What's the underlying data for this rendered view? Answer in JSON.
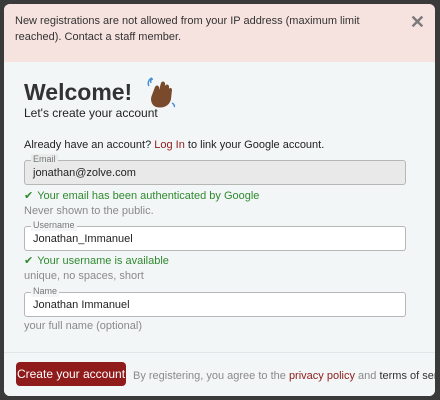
{
  "alert": {
    "message": "New registrations are not allowed from your IP address (maximum limit reached). Contact a staff member.",
    "close": "✕"
  },
  "header": {
    "title": "Welcome!",
    "subtitle": "Let's create your account",
    "wave_icon": "waving-hand-icon"
  },
  "login": {
    "prefix": "Already have an account?",
    "link": "Log In",
    "suffix": "to link your Google account."
  },
  "email": {
    "label": "Email",
    "value": "jonathan@zolve.com",
    "status": "Your email has been authenticated by Google",
    "hint": "Never shown to the public."
  },
  "username": {
    "label": "Username",
    "value": "Jonathan_Immanuel",
    "status": "Your username is available",
    "hint": "unique, no spaces, short"
  },
  "name": {
    "label": "Name",
    "value": "Jonathan Immanuel",
    "hint": "your full name (optional)"
  },
  "footer": {
    "create_button": "Create your account",
    "terms_prefix": "By registering, you agree to the",
    "privacy_link": "privacy policy",
    "and": "and",
    "terms_link": "terms of service",
    "period": "."
  },
  "colors": {
    "accent": "#8f1b1b",
    "success": "#2f8a2f",
    "alert_bg": "#f6e2df"
  }
}
